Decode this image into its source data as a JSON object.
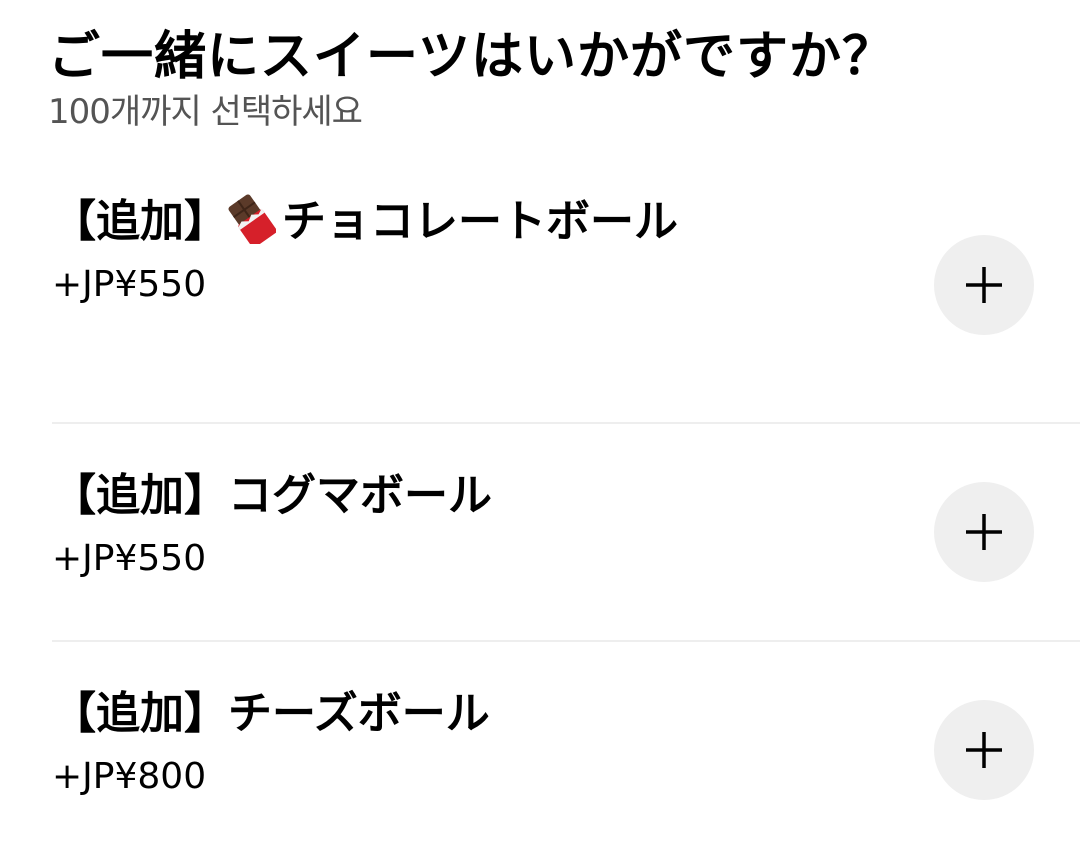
{
  "header": {
    "title": "ご一緒にスイーツはいかがですか？",
    "subtitle": "100개까지 선택하세요"
  },
  "items": [
    {
      "prefix": "【追加】",
      "emoji": "chocolate-bar-icon",
      "name": "チョコレートボール",
      "price": "+JP¥550"
    },
    {
      "prefix": "【追加】",
      "name": "コグマボール",
      "price": "+JP¥550"
    },
    {
      "prefix": "【追加】",
      "name": "チーズボール",
      "price": "+JP¥800"
    }
  ],
  "colors": {
    "text": "#000000",
    "subtitle": "#545454",
    "button_bg": "#efefef",
    "divider": "#eeeeee",
    "chocolate": "#5b3a29",
    "wrapper": "#d6202a"
  }
}
